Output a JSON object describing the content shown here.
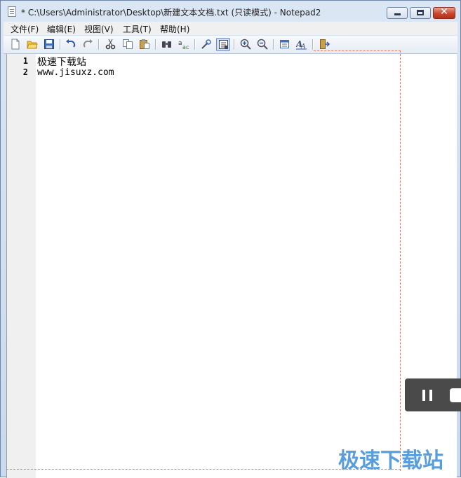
{
  "window": {
    "title": "* C:\\Users\\Administrator\\Desktop\\新建文本文档.txt (只读模式) - Notepad2",
    "close_label": "✕"
  },
  "menu": [
    {
      "label": "文件(F)"
    },
    {
      "label": "编辑(E)"
    },
    {
      "label": "视图(V)"
    },
    {
      "label": "工具(T)"
    },
    {
      "label": "帮助(H)"
    }
  ],
  "toolbar_icons": [
    "new-file-icon",
    "open-folder-icon",
    "save-icon",
    "undo-icon",
    "redo-icon",
    "cut-icon",
    "copy-icon",
    "paste-icon",
    "find-icon",
    "replace-icon",
    "word-wrap-icon",
    "read-only-icon",
    "zoom-in-icon",
    "zoom-out-icon",
    "scheme-icon",
    "font-icon",
    "exit-icon"
  ],
  "editor": {
    "lines": [
      {
        "number": "1",
        "text": "极速下载站"
      },
      {
        "number": "2",
        "text": "www.jisuxz.com"
      }
    ]
  },
  "watermark": "极速下载站",
  "colors": {
    "accent": "#3b8cd6",
    "guide": "#e9765a",
    "close": "#c8462e"
  }
}
